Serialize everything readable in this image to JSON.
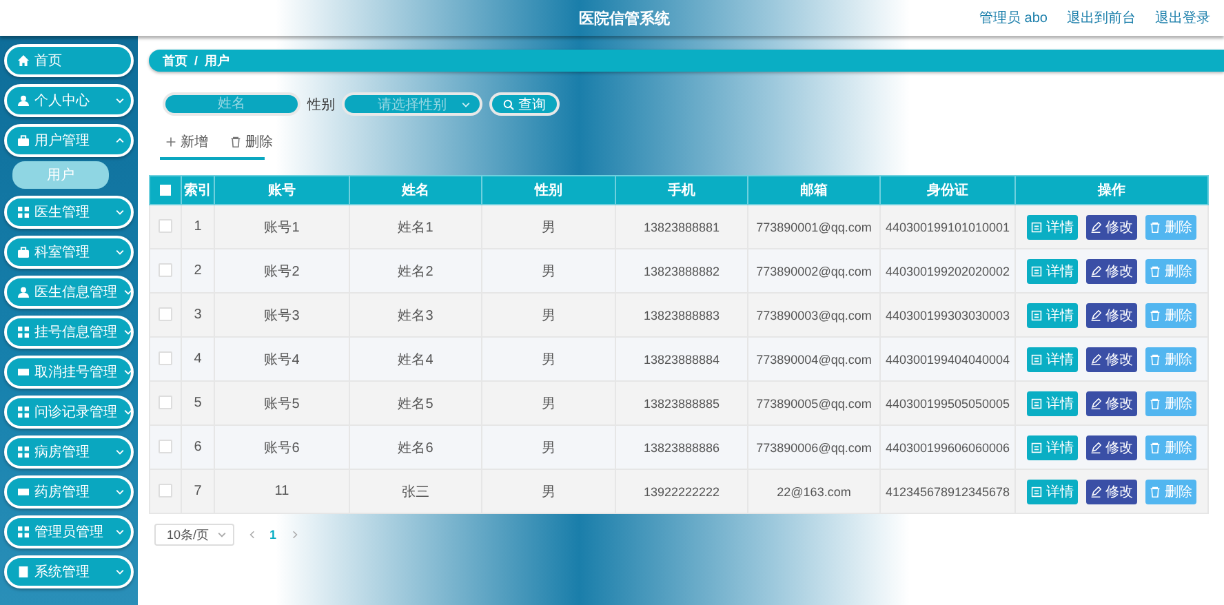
{
  "header": {
    "title": "医院信管系统",
    "links": [
      "管理员 abo",
      "退出到前台",
      "退出登录"
    ]
  },
  "sidebar": {
    "items": [
      {
        "label": "首页",
        "kind": "link"
      },
      {
        "label": "个人中心",
        "kind": "menu",
        "expanded": false
      },
      {
        "label": "用户管理",
        "kind": "menu",
        "expanded": true,
        "children": [
          {
            "label": "用户",
            "selected": true
          }
        ]
      },
      {
        "label": "医生管理",
        "kind": "menu",
        "expanded": false
      },
      {
        "label": "科室管理",
        "kind": "menu",
        "expanded": false
      },
      {
        "label": "医生信息管理",
        "kind": "menu",
        "expanded": false
      },
      {
        "label": "挂号信息管理",
        "kind": "menu",
        "expanded": false
      },
      {
        "label": "取消挂号管理",
        "kind": "menu",
        "expanded": false
      },
      {
        "label": "问诊记录管理",
        "kind": "menu",
        "expanded": false
      },
      {
        "label": "病房管理",
        "kind": "menu",
        "expanded": false
      },
      {
        "label": "药房管理",
        "kind": "menu",
        "expanded": false
      },
      {
        "label": "管理员管理",
        "kind": "menu",
        "expanded": false
      },
      {
        "label": "系统管理",
        "kind": "menu",
        "expanded": false
      }
    ]
  },
  "breadcrumb": {
    "items": [
      "首页",
      "用户"
    ],
    "separator": "/"
  },
  "search": {
    "name_field": {
      "placeholder": "姓名"
    },
    "gender_label": "性别",
    "gender_select": {
      "placeholder": "请选择性别"
    },
    "button": "查询"
  },
  "toolbar": [
    "新增",
    "删除"
  ],
  "table": {
    "select_all": {
      "checked": false
    },
    "columns": [
      "索引",
      "账号",
      "姓名",
      "性别",
      "手机",
      "邮箱",
      "身份证",
      "操作"
    ],
    "rows": [
      {
        "checked": false,
        "cells": [
          "1",
          "账号1",
          "姓名1",
          "男",
          "13823888881",
          "773890001@qq.com",
          "440300199101010001"
        ],
        "actions": [
          "详情",
          "修改",
          "删除"
        ]
      },
      {
        "checked": false,
        "cells": [
          "2",
          "账号2",
          "姓名2",
          "男",
          "13823888882",
          "773890002@qq.com",
          "440300199202020002"
        ],
        "actions": [
          "详情",
          "修改",
          "删除"
        ]
      },
      {
        "checked": false,
        "cells": [
          "3",
          "账号3",
          "姓名3",
          "男",
          "13823888883",
          "773890003@qq.com",
          "440300199303030003"
        ],
        "actions": [
          "详情",
          "修改",
          "删除"
        ]
      },
      {
        "checked": false,
        "cells": [
          "4",
          "账号4",
          "姓名4",
          "男",
          "13823888884",
          "773890004@qq.com",
          "440300199404040004"
        ],
        "actions": [
          "详情",
          "修改",
          "删除"
        ]
      },
      {
        "checked": false,
        "cells": [
          "5",
          "账号5",
          "姓名5",
          "男",
          "13823888885",
          "773890005@qq.com",
          "440300199505050005"
        ],
        "actions": [
          "详情",
          "修改",
          "删除"
        ]
      },
      {
        "checked": false,
        "cells": [
          "6",
          "账号6",
          "姓名6",
          "男",
          "13823888886",
          "773890006@qq.com",
          "440300199606060006"
        ],
        "actions": [
          "详情",
          "修改",
          "删除"
        ]
      },
      {
        "checked": false,
        "cells": [
          "7",
          "11",
          "张三",
          "男",
          "13922222222",
          "22@163.com",
          "412345678912345678"
        ],
        "actions": [
          "详情",
          "修改",
          "删除"
        ]
      }
    ]
  },
  "pager": {
    "page_size": "10条/页",
    "pages": [
      {
        "label": "1",
        "selected": true
      }
    ]
  }
}
